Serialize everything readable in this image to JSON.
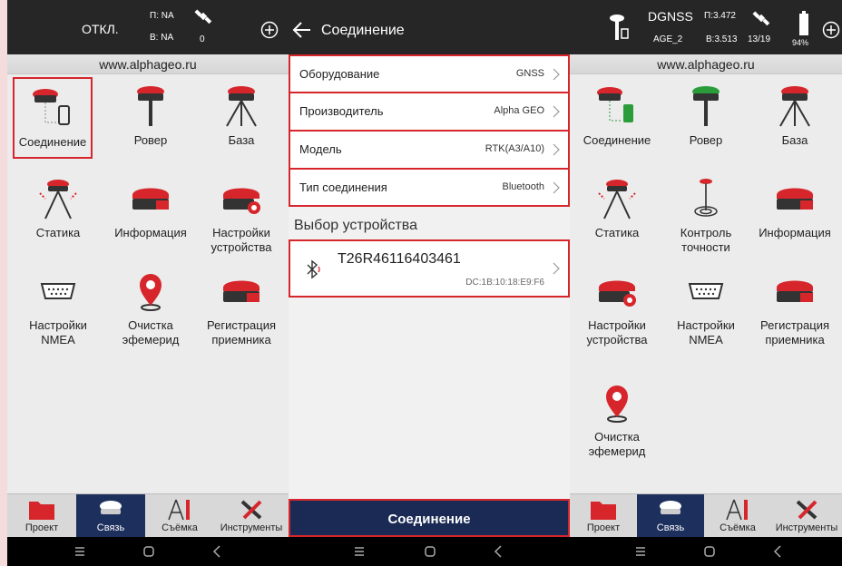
{
  "left_panel": {
    "status": {
      "mode": "ОТКЛ.",
      "p": "П: NA",
      "b": "B: NA",
      "sats": "0"
    },
    "url": "www.alphageo.ru",
    "items": [
      {
        "label": "Соединение",
        "icon": "receiver-phone-icon"
      },
      {
        "label": "Ровер",
        "icon": "rover-pole-icon"
      },
      {
        "label": "База",
        "icon": "base-tripod-icon"
      },
      {
        "label": "Статика",
        "icon": "static-tripod-icon"
      },
      {
        "label": "Информация",
        "icon": "receiver-info-icon"
      },
      {
        "label": "Настройки устройства",
        "icon": "receiver-gear-icon"
      },
      {
        "label": "Настройки NMEA",
        "icon": "serial-port-icon"
      },
      {
        "label": "Очистка эфемерид",
        "icon": "location-pin-icon"
      },
      {
        "label": "Регистрация приемника",
        "icon": "receiver-register-icon"
      }
    ],
    "tabs": [
      "Проект",
      "Связь",
      "Съёмка",
      "Инструменты"
    ]
  },
  "middle_panel": {
    "title": "Соединение",
    "rows": [
      {
        "key": "Оборудование",
        "value": "GNSS"
      },
      {
        "key": "Производитель",
        "value": "Alpha GEO"
      },
      {
        "key": "Модель",
        "value": "RTK(A3/A10)"
      },
      {
        "key": "Тип соединения",
        "value": "Bluetooth"
      }
    ],
    "section_title": "Выбор устройства",
    "device": {
      "name": "T26R46116403461",
      "mac": "DC:1B:10:18:E9:F6"
    },
    "connect_button": "Соединение"
  },
  "right_panel": {
    "status": {
      "mode": "DGNSS",
      "age": "AGE_2",
      "p": "П:3.472",
      "b": "B:3.513",
      "sats": "13/19",
      "battery": "94%"
    },
    "url": "www.alphageo.ru",
    "items": [
      {
        "label": "Соединение",
        "icon": "receiver-phone-connected-icon"
      },
      {
        "label": "Ровер",
        "icon": "rover-pole-icon"
      },
      {
        "label": "База",
        "icon": "base-tripod-icon"
      },
      {
        "label": "Статика",
        "icon": "static-tripod-icon"
      },
      {
        "label": "Контроль точности",
        "icon": "precision-check-icon"
      },
      {
        "label": "Информация",
        "icon": "receiver-info-icon"
      },
      {
        "label": "Настройки устройства",
        "icon": "receiver-gear-icon"
      },
      {
        "label": "Настройки NMEA",
        "icon": "serial-port-icon"
      },
      {
        "label": "Регистрация приемника",
        "icon": "receiver-register-icon"
      },
      {
        "label": "Очистка эфемерид",
        "icon": "location-pin-icon"
      }
    ],
    "tabs": [
      "Проект",
      "Связь",
      "Съёмка",
      "Инструменты"
    ]
  },
  "colors": {
    "accent_red": "#d6262c",
    "navy": "#1b2a55",
    "status_bar": "#262626"
  }
}
